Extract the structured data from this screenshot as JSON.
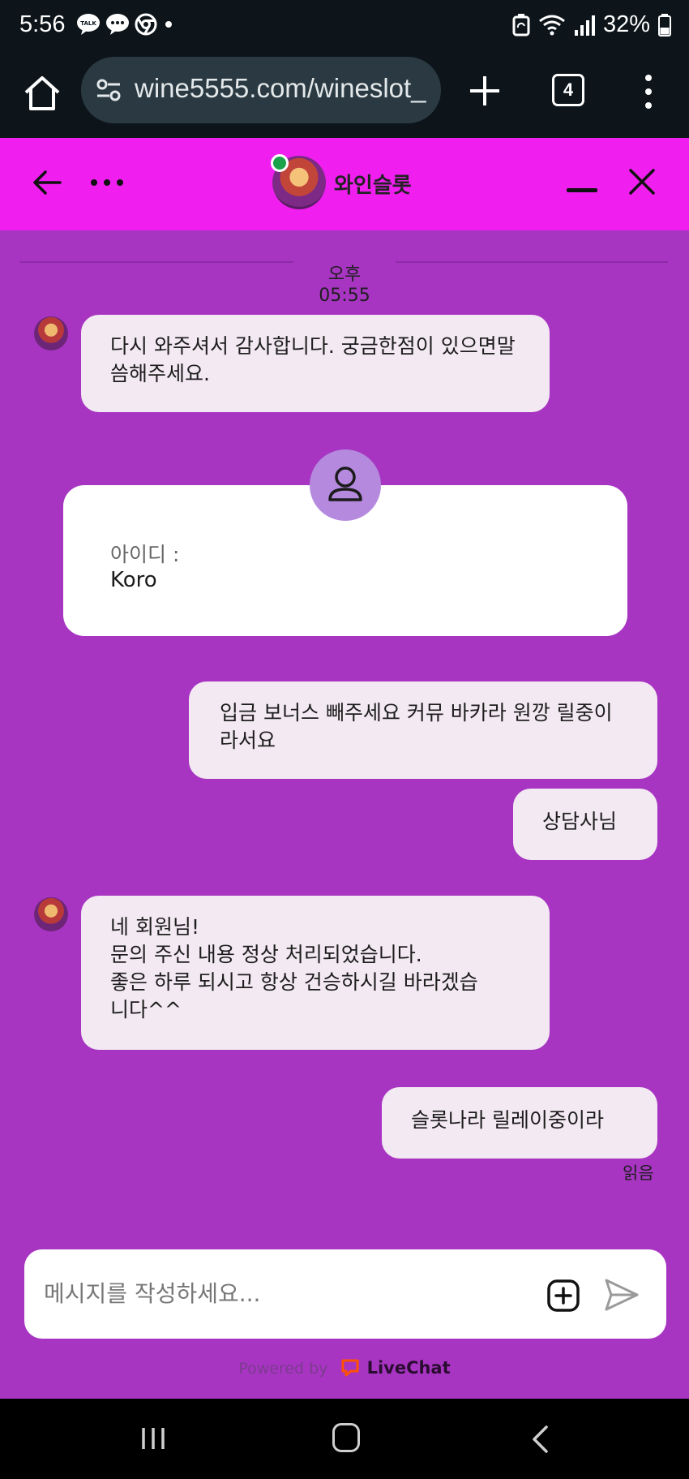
{
  "status_bar": {
    "time": "5:56",
    "battery": "32%",
    "icons": [
      "kakaotalk-icon",
      "chat-icon",
      "chrome-icon",
      "dot-icon",
      "recycle-icon",
      "wifi-icon",
      "signal-icon",
      "battery-icon"
    ]
  },
  "browser": {
    "url": "wine5555.com/wineslot_",
    "tab_count": "4"
  },
  "chat_header": {
    "title": "와인슬롯",
    "online": true
  },
  "chat": {
    "timestamp": "오후 05:55",
    "messages": [
      {
        "from": "agent",
        "text": "다시 와주셔서 감사합니다. 궁금한점이 있으면말씀해주세요."
      },
      {
        "from": "user",
        "text": "입금 보너스 빼주세요 커뮤 바카라 원깡 릴중이라서요"
      },
      {
        "from": "user",
        "text": "상담사님"
      },
      {
        "from": "agent",
        "lines": [
          "네 회원님!",
          "문의 주신 내용 정상 처리되었습니다.",
          "좋은 하루 되시고 항상 건승하시길 바라겠습",
          "니다^^"
        ]
      },
      {
        "from": "user",
        "text": "슬롯나라 릴레이중이라"
      }
    ],
    "info_card": {
      "label": "아이디 :",
      "value": "Koro"
    },
    "read_status": "읽음"
  },
  "composer": {
    "placeholder": "메시지를 작성하세요..."
  },
  "footer": {
    "powered_by": "Powered by",
    "brand": "LiveChat"
  },
  "colors": {
    "header_bg": "#f01ff0",
    "chat_bg": "#a735c2",
    "bubble_bg": "#f3e9f2",
    "online_dot": "#1aa34a",
    "livechat_brand": "#ff5100"
  }
}
